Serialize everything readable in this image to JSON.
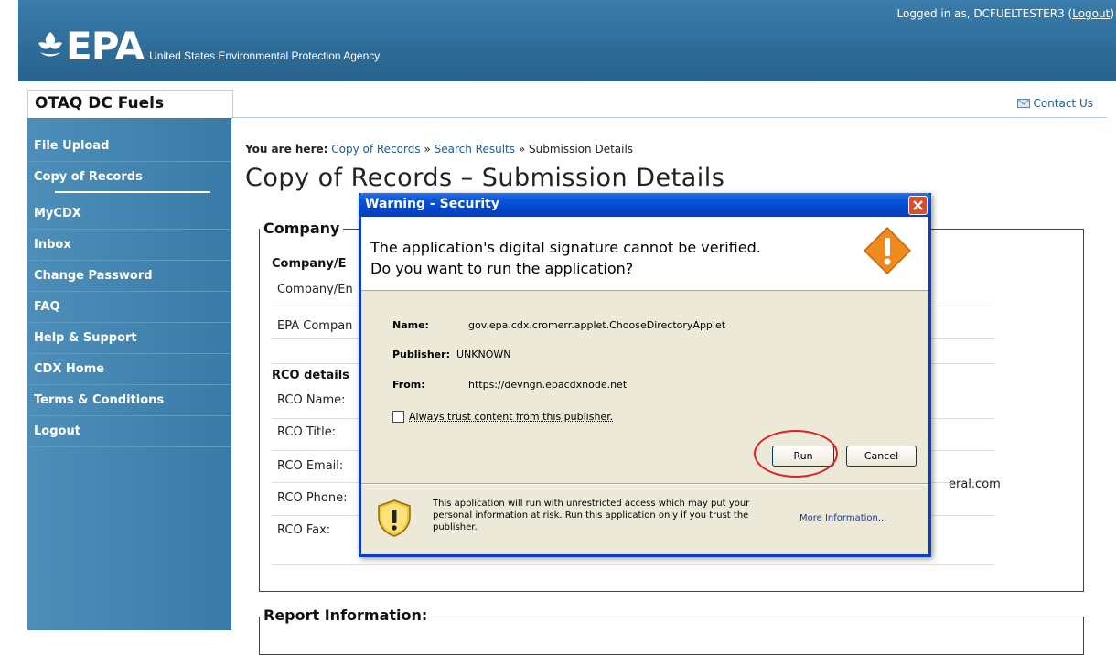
{
  "header": {
    "logo_text": "EPA",
    "agency_name": "United States Environmental Protection Agency",
    "logged_in_prefix": "Logged in as, DCFUELTESTER3 (",
    "logout_link": "Logout",
    "logged_in_suffix": ")"
  },
  "site": {
    "title": "OTAQ DC Fuels",
    "contact_label": "Contact Us"
  },
  "sidebar": {
    "items": [
      {
        "label": "File Upload"
      },
      {
        "label": "Copy of Records"
      },
      {
        "label": "MyCDX"
      },
      {
        "label": "Inbox"
      },
      {
        "label": "Change Password"
      },
      {
        "label": "FAQ"
      },
      {
        "label": "Help & Support"
      },
      {
        "label": "CDX Home"
      },
      {
        "label": "Terms & Conditions"
      },
      {
        "label": "Logout"
      }
    ]
  },
  "breadcrumb": {
    "prefix": "You are here:",
    "crumb1": "Copy of Records",
    "sep": "»",
    "crumb2": "Search Results",
    "current": "Submission Details"
  },
  "main": {
    "heading": "Copy of Records – Submission Details",
    "company_legend": "Company",
    "company_subhead": "Company/E",
    "company_rows": [
      "Company/En",
      "EPA Compan"
    ],
    "rco_subhead": "RCO details",
    "rco_rows": [
      "RCO Name:",
      "RCO Title:",
      "RCO Email:",
      "RCO Phone:",
      "RCO Fax:"
    ],
    "email_fragment": "eral.com",
    "report_legend": "Report Information:"
  },
  "dialog": {
    "title": "Warning - Security",
    "message_line1": "The application's digital signature cannot be verified.",
    "message_line2": "Do you want to run the application?",
    "name_label": "Name:",
    "name_value": "gov.epa.cdx.cromerr.applet.ChooseDirectoryApplet",
    "publisher_label": "Publisher:",
    "publisher_value": "UNKNOWN",
    "from_label": "From:",
    "from_value": "https://devngn.epacdxnode.net",
    "trust_label": "Always trust content from this publisher.",
    "run_label": "Run",
    "cancel_label": "Cancel",
    "risk_text": "This application will run with unrestricted access which may put your personal information at risk. Run this application only if you trust the publisher.",
    "more_info": "More Information..."
  },
  "colors": {
    "header_blue": "#2e6f9c",
    "sidebar_blue": "#3f84b1",
    "xp_title_blue": "#0a54d9",
    "highlight_red": "#e02222"
  }
}
